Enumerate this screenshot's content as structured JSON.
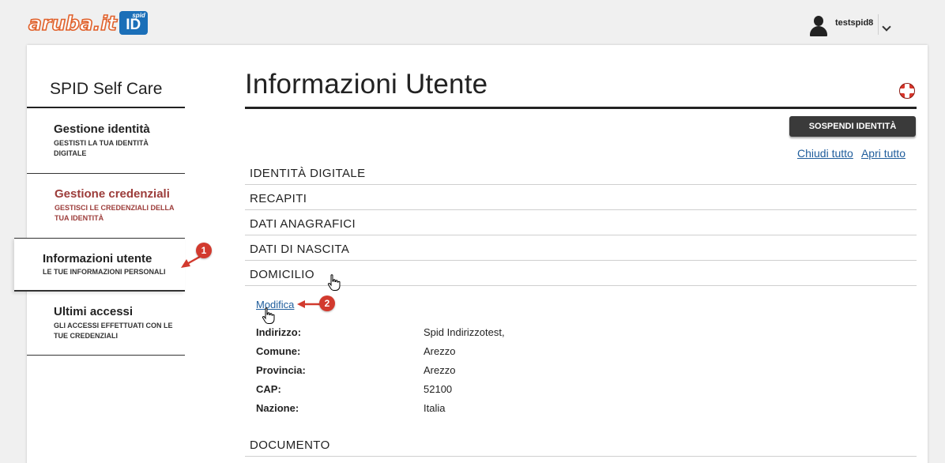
{
  "logo": {
    "text": "aruba.it",
    "badge_small": "spid",
    "badge_large": "ID"
  },
  "user": {
    "name": "testspid8"
  },
  "sidebar": {
    "title": "SPID Self Care",
    "items": [
      {
        "title": "Gestione identità",
        "subtitle": "GESTISTI LA TUA IDENTITÀ DIGITALE"
      },
      {
        "title": "Gestione credenziali",
        "subtitle": "GESTISCI LE CREDENZIALI DELLA TUA IDENTITÀ"
      },
      {
        "title": "Informazioni utente",
        "subtitle": "LE TUE INFORMAZIONI PERSONALI"
      },
      {
        "title": "Ultimi accessi",
        "subtitle": "GLI ACCESSI EFFETTUATI CON LE TUE CREDENZIALI"
      }
    ]
  },
  "main": {
    "title": "Informazioni Utente",
    "suspend_button": "SOSPENDI IDENTITÀ",
    "close_all": "Chiudi tutto",
    "open_all": "Apri tutto",
    "sections": [
      "IDENTITÀ DIGITALE",
      "RECAPITI",
      "DATI ANAGRAFICI",
      "DATI DI NASCITA",
      "DOMICILIO",
      "DOCUMENTO"
    ],
    "edit_link": "Modifica",
    "domicile": [
      {
        "label": "Indirizzo:",
        "value": "Spid Indirizzotest,"
      },
      {
        "label": "Comune:",
        "value": "Arezzo"
      },
      {
        "label": "Provincia:",
        "value": "Arezzo"
      },
      {
        "label": "CAP:",
        "value": "52100"
      },
      {
        "label": "Nazione:",
        "value": "Italia"
      }
    ]
  },
  "annotations": [
    "1",
    "2"
  ],
  "colors": {
    "accent_red": "#d23a2e",
    "link_blue": "#1f5d9c",
    "credentials_red": "#9c3c3a",
    "logo_orange": "#e0602a",
    "logo_blue": "#1b6fb8"
  },
  "icons": {
    "user": "user-icon",
    "caret": "chevron-down-icon",
    "help": "lifebuoy-icon",
    "cursor": "hand-pointer-icon"
  }
}
